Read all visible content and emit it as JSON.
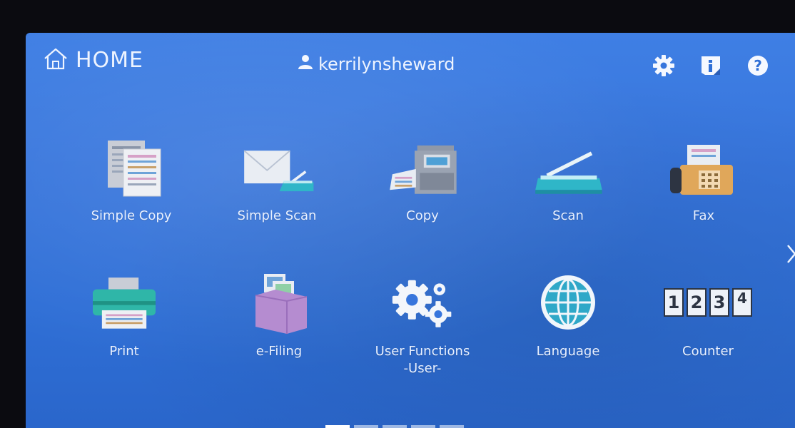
{
  "header": {
    "home_label": "HOME",
    "username": "kerrilynsheward"
  },
  "top_icons": [
    "gear-icon",
    "info-icon",
    "help-icon"
  ],
  "tiles": [
    {
      "label": "Simple Copy",
      "icon": "simple-copy-icon"
    },
    {
      "label": "Simple Scan",
      "icon": "simple-scan-icon"
    },
    {
      "label": "Copy",
      "icon": "copy-machine-icon"
    },
    {
      "label": "Scan",
      "icon": "scanner-icon"
    },
    {
      "label": "Fax",
      "icon": "fax-icon"
    },
    {
      "label": "Print",
      "icon": "printer-icon"
    },
    {
      "label": "e-Filing",
      "icon": "e-filing-icon"
    },
    {
      "label": "User Functions",
      "label2": "-User-",
      "icon": "user-functions-gears-icon"
    },
    {
      "label": "Language",
      "icon": "globe-icon"
    },
    {
      "label": "Counter",
      "icon": "counter-icon"
    }
  ],
  "counter_digits": [
    "1",
    "2",
    "3",
    "4"
  ],
  "colors": {
    "background": "#3775dc",
    "text": "#e8f0ff",
    "accent_teal": "#2fb6c8"
  }
}
